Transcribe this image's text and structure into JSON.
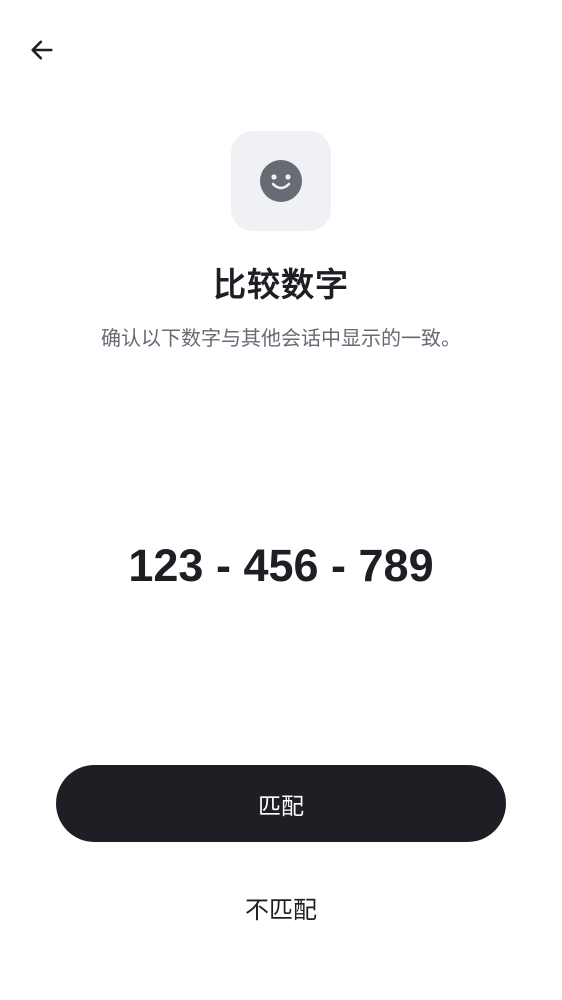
{
  "header": {
    "back_icon": "arrow-left-icon"
  },
  "hero": {
    "icon": "smiley-face-icon",
    "tile_color": "#eff1f5",
    "icon_color": "#666b74"
  },
  "content": {
    "title": "比较数字",
    "subtitle": "确认以下数字与其他会话中显示的一致。",
    "code": "123 - 456 - 789"
  },
  "actions": {
    "match_label": "匹配",
    "mismatch_label": "不匹配",
    "primary_color": "#1e1f24"
  }
}
